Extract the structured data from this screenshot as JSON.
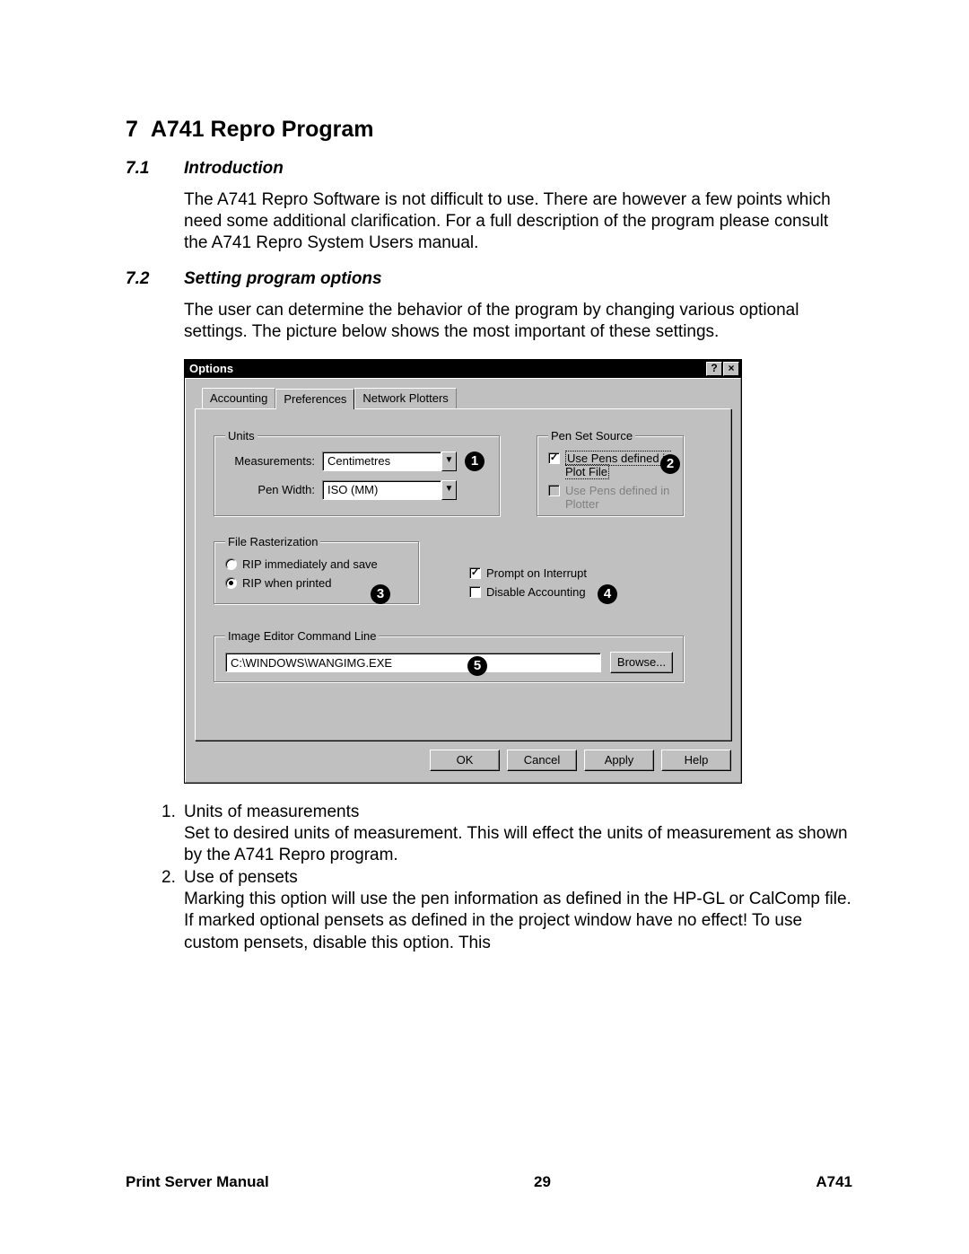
{
  "heading": {
    "num": "7",
    "title": "A741 Repro Program"
  },
  "sections": {
    "s1": {
      "num": "7.1",
      "title": "Introduction",
      "text": "The A741 Repro Software is not difficult to use. There are however a few points which need some additional clarification. For a full description of the program please consult the A741 Repro System Users manual."
    },
    "s2": {
      "num": "7.2",
      "title": "Setting program options",
      "text": "The user can determine the behavior of the program by changing various optional settings. The picture below shows the most important of these settings."
    }
  },
  "dialog": {
    "title": "Options",
    "help_btn": "?",
    "close_btn": "×",
    "tabs": {
      "accounting": "Accounting",
      "preferences": "Preferences",
      "network": "Network Plotters"
    },
    "units": {
      "legend": "Units",
      "measurements_label": "Measurements:",
      "measurements_value": "Centimetres",
      "penwidth_label": "Pen Width:",
      "penwidth_value": "ISO (MM)"
    },
    "pensource": {
      "legend": "Pen Set Source",
      "opt1": "Use Pens defined in Plot File",
      "opt2": "Use Pens defined in Plotter"
    },
    "raster": {
      "legend": "File Rasterization",
      "opt1": "RIP immediately and save",
      "opt2": "RIP when printed"
    },
    "misc": {
      "prompt": "Prompt on Interrupt",
      "disable": "Disable Accounting"
    },
    "editor": {
      "legend": "Image Editor Command Line",
      "value": "C:\\WINDOWS\\WANGIMG.EXE",
      "browse": "Browse..."
    },
    "buttons": {
      "ok": "OK",
      "cancel": "Cancel",
      "apply": "Apply",
      "help": "Help"
    },
    "callouts": {
      "c1": "1",
      "c2": "2",
      "c3": "3",
      "c4": "4",
      "c5": "5"
    }
  },
  "list": {
    "i1": {
      "num": "1.",
      "title": "Units of measurements",
      "text": "Set to desired units of measurement. This will effect the units of measurement as shown by the A741 Repro program."
    },
    "i2": {
      "num": "2.",
      "title": "Use of pensets",
      "text": "Marking this option will use the pen information as defined in the HP-GL or CalComp file. If marked optional pensets as defined in the project window have no effect! To use custom pensets, disable this option. This"
    }
  },
  "footer": {
    "left": "Print Server Manual",
    "center": "29",
    "right": "A741"
  }
}
